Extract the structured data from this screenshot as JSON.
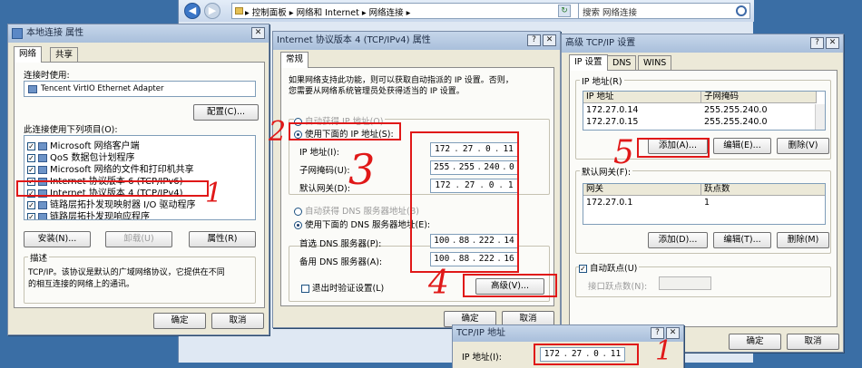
{
  "explorer": {
    "breadcrumb": "▸ 控制面板 ▸ 网络和 Internet ▸ 网络连接 ▸",
    "search_placeholder": "搜索 网络连接"
  },
  "props_win": {
    "title": "本地连接 属性",
    "tabs": [
      "网络",
      "共享"
    ],
    "connect_using_label": "连接时使用:",
    "adapter_name": "Tencent VirtIO Ethernet Adapter",
    "configure_btn": "配置(C)...",
    "items_label": "此连接使用下列项目(O):",
    "items": [
      "Microsoft 网络客户端",
      "QoS 数据包计划程序",
      "Microsoft 网络的文件和打印机共享",
      "Internet 协议版本 6 (TCP/IPv6)",
      "Internet 协议版本 4 (TCP/IPv4)",
      "链路层拓扑发现映射器 I/O 驱动程序",
      "链路层拓扑发现响应程序"
    ],
    "install_btn": "安装(N)...",
    "uninstall_btn": "卸载(U)",
    "properties_btn": "属性(R)",
    "desc_label": "描述",
    "desc_text_1": "TCP/IP。该协议是默认的广域网络协议，它提供在不同",
    "desc_text_2": "的相互连接的网络上的通讯。",
    "ok_btn": "确定",
    "cancel_btn": "取消"
  },
  "ipv4_win": {
    "title": "Internet 协议版本 4 (TCP/IPv4) 属性",
    "tab": "常规",
    "intro_1": "如果网络支持此功能，则可以获取自动指派的 IP 设置。否则，",
    "intro_2": "您需要从网络系统管理员处获得适当的 IP 设置。",
    "auto_ip": "自动获得 IP 地址(O)",
    "manual_ip": "使用下面的 IP 地址(S):",
    "ip_label": "IP 地址(I):",
    "mask_label": "子网掩码(U):",
    "gateway_label": "默认网关(D):",
    "ip": [
      "172",
      "27",
      "0",
      "11"
    ],
    "mask": [
      "255",
      "255",
      "240",
      "0"
    ],
    "gateway": [
      "172",
      "27",
      "0",
      "1"
    ],
    "auto_dns": "自动获得 DNS 服务器地址(B)",
    "manual_dns": "使用下面的 DNS 服务器地址(E):",
    "dns1_label": "首选 DNS 服务器(P):",
    "dns2_label": "备用 DNS 服务器(A):",
    "dns1": [
      "100",
      "88",
      "222",
      "14"
    ],
    "dns2": [
      "100",
      "88",
      "222",
      "16"
    ],
    "validate": "退出时验证设置(L)",
    "advanced_btn": "高级(V)...",
    "ok_btn": "确定",
    "cancel_btn": "取消"
  },
  "adv_win": {
    "title": "高级 TCP/IP 设置",
    "tabs": [
      "IP 设置",
      "DNS",
      "WINS"
    ],
    "ip_group": "IP 地址(R)",
    "col_ip": "IP 地址",
    "col_mask": "子网掩码",
    "rows": [
      {
        "ip": "172.27.0.14",
        "mask": "255.255.240.0"
      },
      {
        "ip": "172.27.0.15",
        "mask": "255.255.240.0"
      }
    ],
    "add_btn": "添加(A)...",
    "edit_btn": "编辑(E)...",
    "delete_btn": "删除(V)",
    "gw_group": "默认网关(F):",
    "col_gw": "网关",
    "col_metric": "跃点数",
    "gw_row": {
      "gw": "172.27.0.1",
      "metric": "1"
    },
    "gw_add_btn": "添加(D)...",
    "gw_edit_btn": "编辑(T)...",
    "gw_delete_btn": "删除(M)",
    "auto_metric": "自动跃点(U)",
    "iface_metric": "接口跃点数(N):",
    "ok_btn": "确定",
    "cancel_btn": "取消"
  },
  "tcpip_addr_win": {
    "title": "TCP/IP 地址",
    "ip_label": "IP 地址(I):",
    "ip": [
      "172",
      "27",
      "0",
      "11"
    ]
  },
  "annotations": [
    "2",
    "3",
    "4",
    "5",
    "1",
    "1"
  ],
  "colors": {
    "annotation_red": "#e01818",
    "desktop": "#3a6ea5",
    "dialog_bg": "#ece9d8"
  }
}
